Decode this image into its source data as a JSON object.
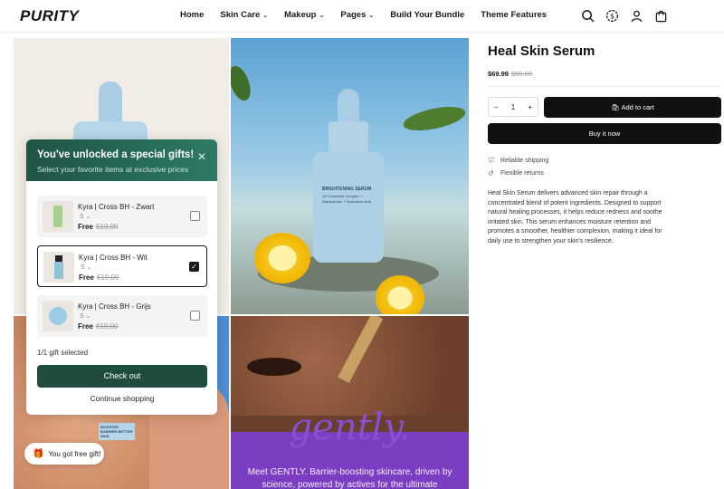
{
  "header": {
    "logo": "PURITY",
    "nav": [
      {
        "label": "Home",
        "dropdown": false
      },
      {
        "label": "Skin Care",
        "dropdown": true
      },
      {
        "label": "Makeup",
        "dropdown": true
      },
      {
        "label": "Pages",
        "dropdown": true
      },
      {
        "label": "Build Your Bundle",
        "dropdown": false
      },
      {
        "label": "Theme Features",
        "dropdown": false
      }
    ],
    "icons": [
      "search-icon",
      "currency-icon",
      "account-icon",
      "cart-icon"
    ]
  },
  "gallery": {
    "serum_label": "BRIGHTENING SERUM",
    "serum_sublabel": "1% Ceramide Complex + Niacinamide + Hyaluronic Acid",
    "tube_label": "BOOSTED BARRIER BETTER SKIN",
    "brand_word": "gently.",
    "brand_tagline": "Meet GENTLY. Barrier-boosting skincare, driven by science, powered by actives for the ultimate"
  },
  "popup": {
    "title": "You've unlocked a special gifts!",
    "subtitle": "Select your favorite items at exclusive prices",
    "close_icon": "close-icon",
    "gifts": [
      {
        "name": "Kyra | Cross BH - Zwart",
        "size": "S",
        "price": "Free",
        "old_price": "€19,00",
        "selected": false
      },
      {
        "name": "Kyra | Cross BH - Wit",
        "size": "S",
        "price": "Free",
        "old_price": "€19,00",
        "selected": true
      },
      {
        "name": "Kyra | Cross BH - Grijs",
        "size": "S",
        "price": "Free",
        "old_price": "€19,00",
        "selected": false
      }
    ],
    "selected_count": "1/1 gift selected",
    "checkout_label": "Check out",
    "continue_label": "Continue shopping"
  },
  "gift_chip": {
    "label": "You got free gift!",
    "icon": "gift-icon"
  },
  "product": {
    "title": "Heal Skin Serum",
    "price": "$69.99",
    "compare_price": "$60.00",
    "quantity": "1",
    "add_to_cart": "Add to cart",
    "buy_now": "Buy it now",
    "features": [
      {
        "icon": "truck-icon",
        "label": "Reliable shipping"
      },
      {
        "icon": "return-icon",
        "label": "Flexible returns"
      }
    ],
    "description": "Heal Skin Serum delivers advanced skin repair through a concentrated blend of potent ingredients. Designed to support natural healing processes, it helps reduce redness and soothe irritated skin. This serum enhances moisture retention and promotes a smoother, healthier complexion, making it ideal for daily use to strengthen your skin's resilience."
  },
  "colors": {
    "accent_green": "#1e4d40",
    "button_black": "#111111"
  }
}
